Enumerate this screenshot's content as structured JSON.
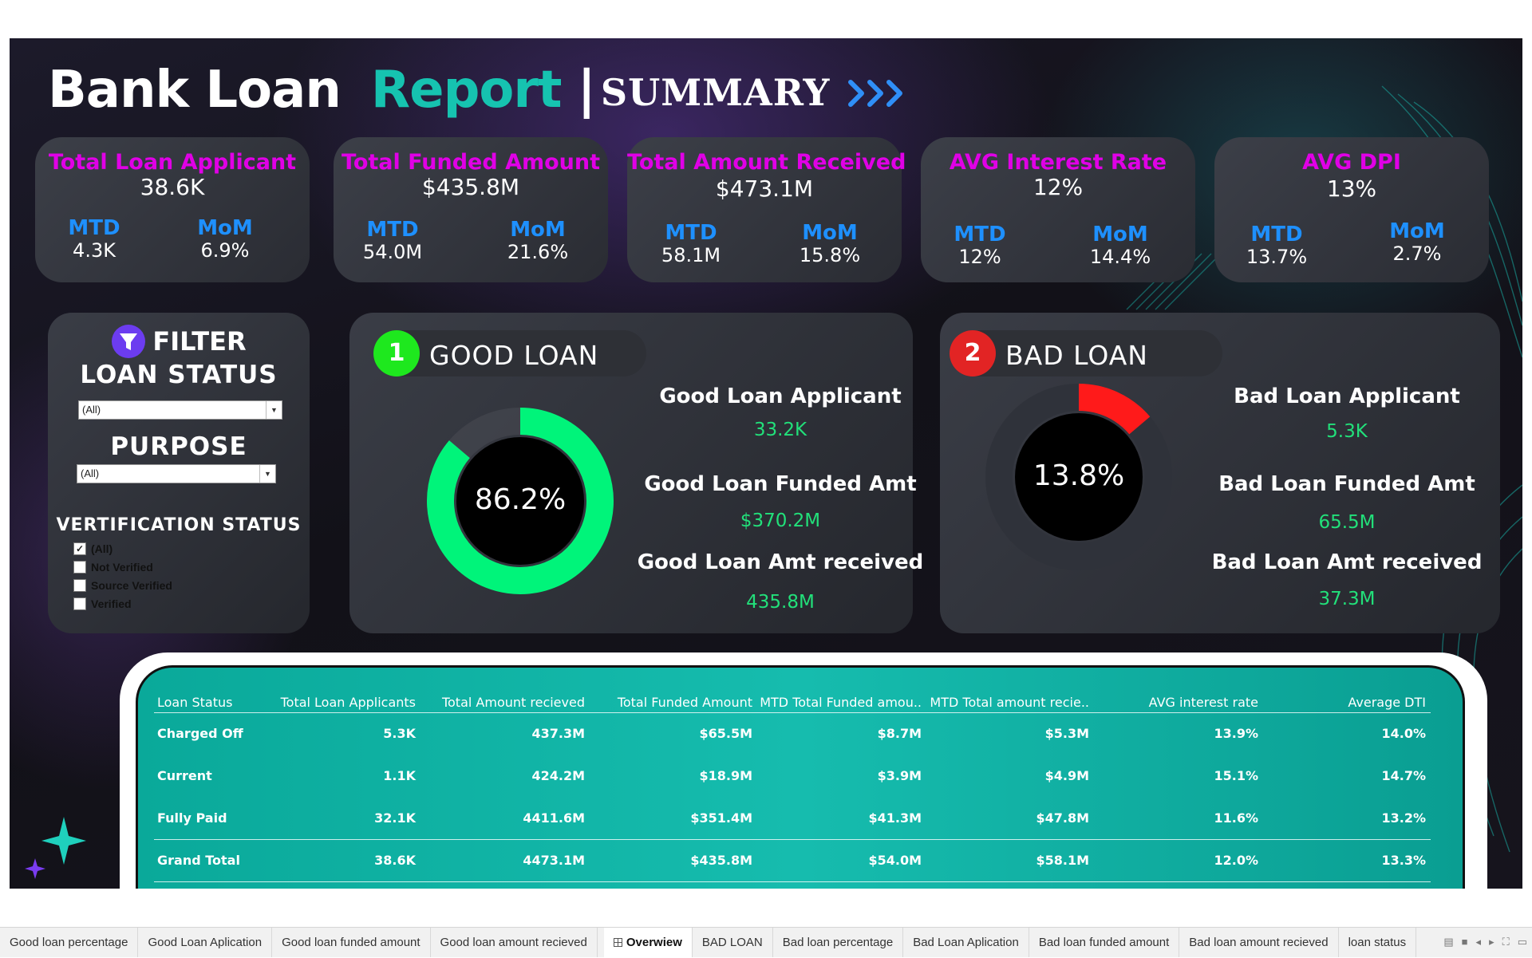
{
  "header": {
    "bank_loan": "Bank Loan",
    "report": "Report",
    "bar": "|",
    "summary": "SUMMARY"
  },
  "kpis": [
    {
      "title": "Total Loan Applicant",
      "value": "38.6K",
      "mtd_label": "MTD",
      "mtd": "4.3K",
      "mom_label": "MoM",
      "mom": "6.9%"
    },
    {
      "title": "Total Funded Amount",
      "value": "$435.8M",
      "mtd_label": "MTD",
      "mtd": "54.0M",
      "mom_label": "MoM",
      "mom": "21.6%"
    },
    {
      "title": "Total Amount Received",
      "value": "$473.1M",
      "mtd_label": "MTD",
      "mtd": "58.1M",
      "mom_label": "MoM",
      "mom": "15.8%"
    },
    {
      "title": "AVG Interest Rate",
      "value": "12%",
      "mtd_label": "MTD",
      "mtd": "12%",
      "mom_label": "MoM",
      "mom": "14.4%"
    },
    {
      "title": "AVG DPI",
      "value": "13%",
      "mtd_label": "MTD",
      "mtd": "13.7%",
      "mom_label": "MoM",
      "mom": "2.7%"
    }
  ],
  "filter": {
    "heading": "FILTER",
    "loan_status_label": "LOAN STATUS",
    "loan_status_value": "(All)",
    "purpose_label": "PURPOSE",
    "purpose_value": "(All)",
    "verification_label": "VERTIFICATION STATUS",
    "verification_options": [
      {
        "label": "(All)",
        "checked": true
      },
      {
        "label": "Not Verified",
        "checked": false
      },
      {
        "label": "Source Verified",
        "checked": false
      },
      {
        "label": "Verified",
        "checked": false
      }
    ]
  },
  "good_loan": {
    "badge": "1",
    "label": "GOOD LOAN",
    "badge_color": "#1ee81e",
    "percent_label": "86.2%",
    "percent": 86.2,
    "ring_color": "#00f47a",
    "applicant_label": "Good Loan Applicant",
    "applicant": "33.2K",
    "funded_label": "Good Loan Funded Amt",
    "funded": "$370.2M",
    "received_label": "Good Loan Amt received",
    "received": "435.8M"
  },
  "bad_loan": {
    "badge": "2",
    "label": "BAD LOAN",
    "badge_color": "#e22424",
    "percent_label": "13.8%",
    "percent": 13.8,
    "ring_color": "#ff1a1a",
    "applicant_label": "Bad Loan Applicant",
    "applicant": "5.3K",
    "funded_label": "Bad Loan Funded Amt",
    "funded": "65.5M",
    "received_label": "Bad Loan Amt received",
    "received": "37.3M"
  },
  "table": {
    "headers": [
      "Loan Status",
      "Total Loan Applicants",
      "Total Amount recieved",
      "Total Funded Amount",
      "MTD Total Funded amou..",
      "MTD Total amount recie..",
      "AVG interest rate",
      "Average DTI"
    ],
    "rows": [
      [
        "Charged Off",
        "5.3K",
        "437.3M",
        "$65.5M",
        "$8.7M",
        "$5.3M",
        "13.9%",
        "14.0%"
      ],
      [
        "Current",
        "1.1K",
        "424.2M",
        "$18.9M",
        "$3.9M",
        "$4.9M",
        "15.1%",
        "14.7%"
      ],
      [
        "Fully Paid",
        "32.1K",
        "4411.6M",
        "$351.4M",
        "$41.3M",
        "$47.8M",
        "11.6%",
        "13.2%"
      ]
    ],
    "total": [
      "Grand Total",
      "38.6K",
      "4473.1M",
      "$435.8M",
      "$54.0M",
      "$58.1M",
      "12.0%",
      "13.3%"
    ]
  },
  "tabs": [
    {
      "label": "Good loan percentage",
      "active": false
    },
    {
      "label": "Good Loan Aplication",
      "active": false
    },
    {
      "label": "Good loan funded amount",
      "active": false
    },
    {
      "label": "Good loan amount recieved",
      "active": false
    },
    {
      "label": "Overwiew",
      "active": true
    },
    {
      "label": "BAD LOAN",
      "active": false
    },
    {
      "label": "Bad loan percentage",
      "active": false
    },
    {
      "label": "Bad Loan Aplication",
      "active": false
    },
    {
      "label": "Bad loan funded amount",
      "active": false
    },
    {
      "label": "Bad loan amount recieved",
      "active": false
    },
    {
      "label": "loan status",
      "active": false
    }
  ],
  "colors": {
    "accent_teal": "#16c3b0",
    "kpi_title": "#e000e6",
    "kpi_sub": "#1e90ff",
    "positive": "#22e07a"
  }
}
